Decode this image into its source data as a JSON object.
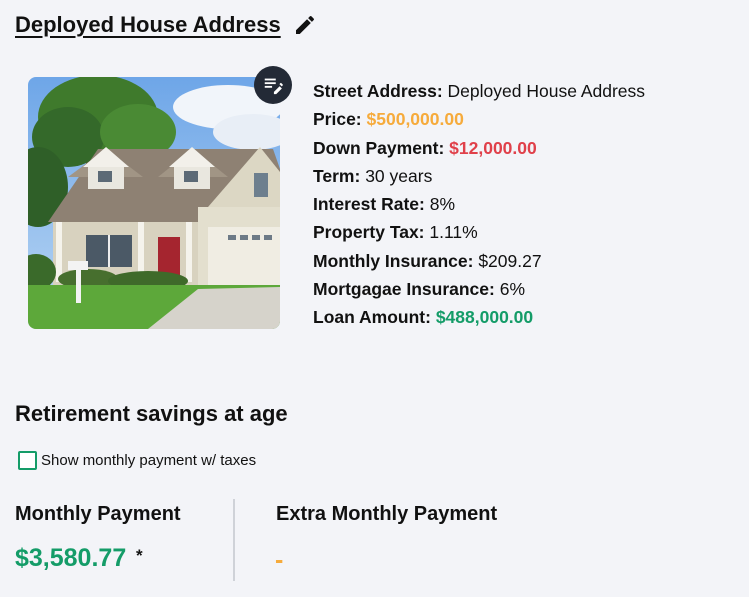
{
  "header": {
    "title": "Deployed House Address",
    "edit_icon": "pencil-icon"
  },
  "property": {
    "image_alt": "house-photo",
    "notes_icon": "notes-edit-icon",
    "details": [
      {
        "label": "Street Address:",
        "value": "Deployed House Address",
        "style": "plain"
      },
      {
        "label": "Price:",
        "value": "$500,000.00",
        "style": "orange"
      },
      {
        "label": "Down Payment:",
        "value": "$12,000.00",
        "style": "red"
      },
      {
        "label": "Term:",
        "value": "30 years",
        "style": "plain"
      },
      {
        "label": "Interest Rate:",
        "value": "8%",
        "style": "plain"
      },
      {
        "label": "Property Tax:",
        "value": "1.11%",
        "style": "plain"
      },
      {
        "label": "Monthly Insurance:",
        "value": "$209.27",
        "style": "plain"
      },
      {
        "label": "Mortgagae Insurance:",
        "value": "6%",
        "style": "plain"
      },
      {
        "label": "Loan Amount:",
        "value": "$488,000.00",
        "style": "green"
      }
    ]
  },
  "retirement": {
    "title": "Retirement savings at age",
    "checkbox_label": "Show monthly payment w/ taxes",
    "checkbox_checked": false
  },
  "payments": {
    "monthly_label": "Monthly Payment",
    "monthly_value": "$3,580.77",
    "monthly_note": "*",
    "extra_label": "Extra Monthly Payment",
    "extra_value": "-"
  },
  "colors": {
    "accent_green": "#149c68",
    "accent_orange": "#f6ab3c",
    "accent_red": "#e0404a",
    "background": "#f3f4f8"
  }
}
